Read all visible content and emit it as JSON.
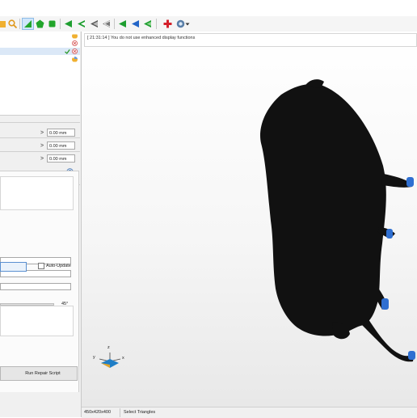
{
  "log": {
    "message": "[ 21:31:14 ] You do not use enhanced display functions"
  },
  "transform": {
    "rows": [
      {
        "arrow": ">",
        "value": "0.00 mm"
      },
      {
        "arrow": ">",
        "value": "0.00 mm"
      },
      {
        "arrow": ">",
        "value": "0.00 mm"
      }
    ]
  },
  "repair": {
    "auto_update_label": "Auto-Update",
    "angle_value": "45°",
    "run_script_label": "Run Repair Script"
  },
  "axis": {
    "x_label": "x",
    "y_label": "y",
    "z_label": "z"
  },
  "status": {
    "size": "450x420x400",
    "mode": "Select Triangles"
  },
  "colors": {
    "model": "#111111",
    "highlight": "#2f6fd1",
    "toolbar_selected": "#cfe6fb"
  },
  "toolbar_icons": [
    "folder-icon",
    "zoom-icon",
    "select-triangle-icon",
    "select-pentagon-icon",
    "select-square-icon",
    "prev-icon",
    "fill-icon",
    "shade-icon",
    "reset-icon",
    "prev-triangle-icon",
    "prev-blue-icon",
    "left-green-icon",
    "add-part-icon",
    "settings-icon"
  ]
}
